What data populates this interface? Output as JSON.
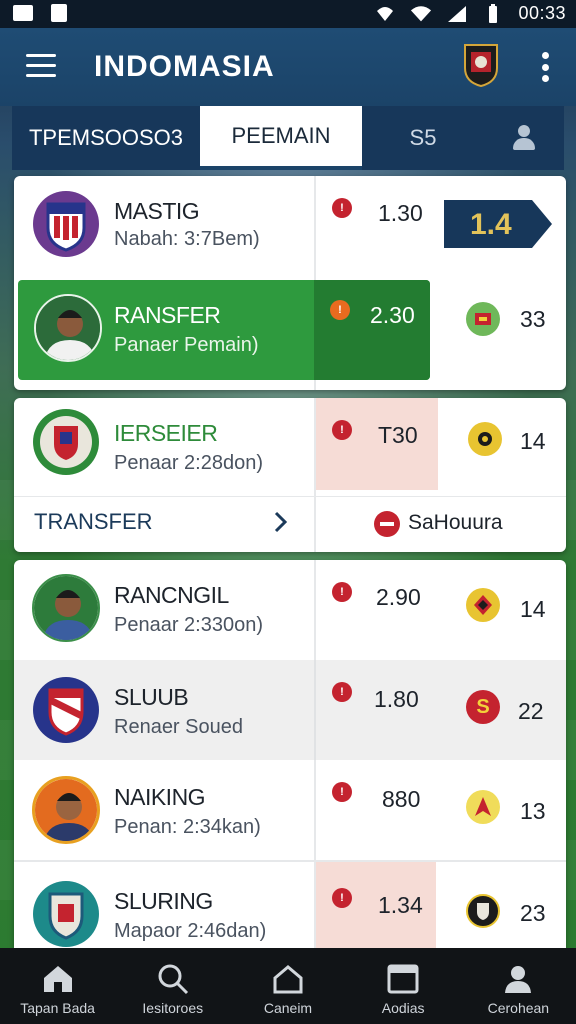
{
  "status_bar": {
    "time": "00:33"
  },
  "app_bar": {
    "title": "INDOMASIA"
  },
  "tabs": [
    {
      "label": "TPEMSOOSO3"
    },
    {
      "label": "PEEMAIN"
    },
    {
      "label": "S5"
    }
  ],
  "rows": [
    {
      "name": "MASTIG",
      "sub": "Nabah: 3:7Bem)",
      "odds": "1.30",
      "highlight": "1.4"
    },
    {
      "name": "RANSFER",
      "sub": "Panaer Pemain)",
      "odds": "2.30",
      "count": "33"
    },
    {
      "name": "IERSEIER",
      "sub": "Penaar 2:28don)",
      "odds": "T30",
      "count": "14"
    },
    {
      "name": "RANCNGIL",
      "sub": "Penaar 2:330on)",
      "odds": "2.90",
      "count": "14"
    },
    {
      "name": "SLUUB",
      "sub": "Renaer Soued",
      "odds": "1.80",
      "count": "22"
    },
    {
      "name": "NAIKING",
      "sub": "Penan: 2:34kan)",
      "odds": "880",
      "count": "13"
    },
    {
      "name": "SLURING",
      "sub": "Mapaor 2:46dan)",
      "odds": "1.34",
      "count": "23"
    }
  ],
  "transfer_row": {
    "label": "TRANSFER",
    "action": "SaHouura"
  },
  "bottom_nav": [
    {
      "label": "Tapan Bada"
    },
    {
      "label": "Iesitoroes"
    },
    {
      "label": "Caneim"
    },
    {
      "label": "Aodias"
    },
    {
      "label": "Cerohean"
    }
  ],
  "colors": {
    "primary": "#1b4368",
    "accent_green": "#2e9a3e",
    "danger": "#c4232f",
    "navy_badge": "#17375a"
  },
  "icons": [
    "menu-icon",
    "more-vert-icon",
    "user-icon",
    "chevron-right-icon",
    "home-icon",
    "search-icon",
    "house-icon",
    "calendar-icon",
    "profile-icon"
  ]
}
